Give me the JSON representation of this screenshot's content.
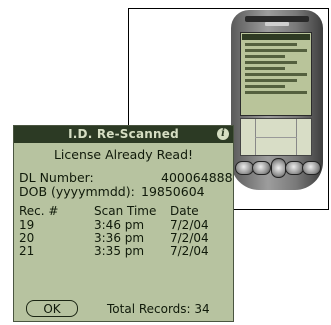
{
  "device_photo": {
    "icon": "palm-handheld-photo"
  },
  "dialog": {
    "title": "I.D. Re-Scanned",
    "info_icon": "i",
    "message": "License Already Read!",
    "dl_label": "DL Number:",
    "dl_value": "400064888",
    "dob_label": "DOB (yyyymmdd):",
    "dob_value": "19850604",
    "table": {
      "headers": [
        "Rec. #",
        "Scan Time",
        "Date"
      ],
      "rows": [
        [
          "19",
          "3:46 pm",
          "7/2/04"
        ],
        [
          "20",
          "3:36 pm",
          "7/2/04"
        ],
        [
          "21",
          "3:35 pm",
          "7/2/04"
        ]
      ]
    },
    "ok_label": "OK",
    "total_records": "Total Records: 34"
  },
  "colors": {
    "screen_bg": "#b7c3a0",
    "titlebar_bg": "#2c3a24",
    "text": "#101a0a"
  }
}
